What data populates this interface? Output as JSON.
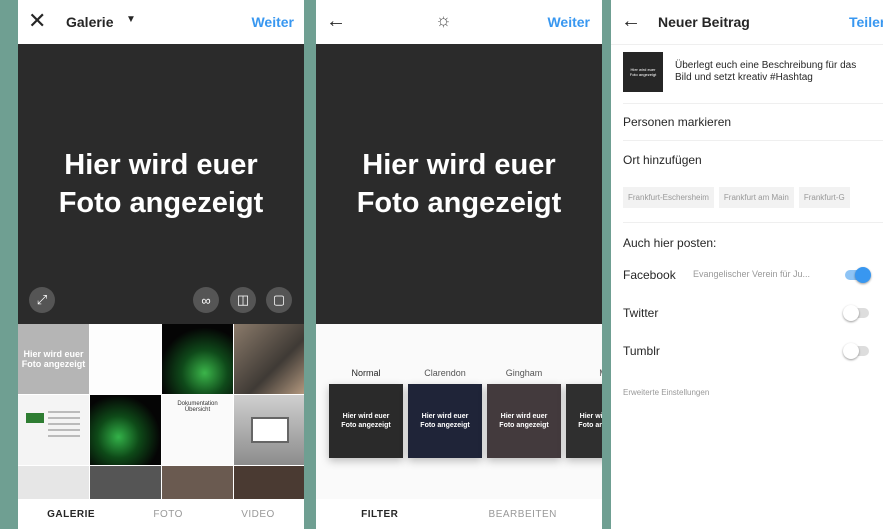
{
  "gallery": {
    "title": "Galerie",
    "next_label": "Weiter",
    "preview_text": "Hier wird euer\nFoto angezeigt",
    "tabs": [
      "GALERIE",
      "FOTO",
      "VIDEO"
    ],
    "thumb_text": "Hier wird euer\nFoto angezeigt",
    "doc_title": "Dokumentation Übersicht"
  },
  "filter_screen": {
    "next_label": "Weiter",
    "preview_text": "Hier wird euer\nFoto angezeigt",
    "filters": [
      {
        "name": "Normal",
        "thumb_text": "Hier wird euer\nFoto angezeigt",
        "color": "#2a2a2a"
      },
      {
        "name": "Clarendon",
        "thumb_text": "Hier wird euer\nFoto angezeigt",
        "color": "#1f2438"
      },
      {
        "name": "Gingham",
        "thumb_text": "Hier wird euer\nFoto angezeigt",
        "color": "#433a3d"
      },
      {
        "name": "M",
        "thumb_text": "Hier wird euer\nFoto angezeigt",
        "color": "#2f2f2f"
      }
    ],
    "tabs": [
      "FILTER",
      "BEARBEITEN"
    ]
  },
  "new_post": {
    "title": "Neuer Beitrag",
    "share_label": "Teilen",
    "thumb_text": "Hier wird euer\nFoto angezeigt",
    "caption": "Überlegt euch eine Beschreibung für das Bild und setzt kreativ #Hashtag",
    "tag_people": "Personen markieren",
    "add_location": "Ort hinzufügen",
    "location_chips": [
      "Frankfurt-Eschersheim",
      "Frankfurt am Main",
      "Frankfurt-G"
    ],
    "also_post": "Auch hier posten:",
    "facebook": "Facebook",
    "facebook_page": "Evangelischer Verein für Ju...",
    "twitter": "Twitter",
    "tumblr": "Tumblr",
    "advanced": "Erweiterte Einstellungen"
  },
  "colors": {
    "accent": "#3897f0",
    "dark": "#2b2b2b",
    "background": "#6f9f92"
  }
}
